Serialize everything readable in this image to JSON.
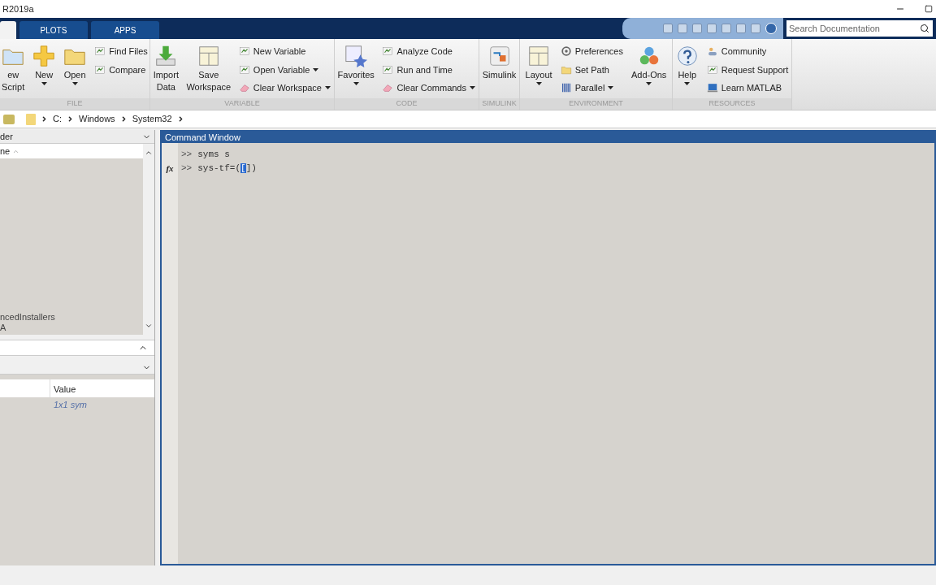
{
  "window": {
    "title": "R2019a"
  },
  "tabs": [
    {
      "selected": true
    },
    {
      "label": "PLOTS",
      "selected": false
    },
    {
      "label": "APPS",
      "selected": false
    }
  ],
  "search": {
    "placeholder": "Search Documentation"
  },
  "ribbon": [
    {
      "label": "FILE",
      "items": [
        {
          "kind": "large",
          "lines": [
            "ew",
            "Script"
          ],
          "dropdown": false
        },
        {
          "kind": "large",
          "lines": [
            "New"
          ],
          "dropdown": true
        },
        {
          "kind": "large",
          "lines": [
            "Open"
          ],
          "dropdown": true
        },
        {
          "kind": "stack",
          "items": [
            {
              "label": "Find Files",
              "dropdown": false
            },
            {
              "label": "Compare",
              "dropdown": false
            }
          ]
        }
      ]
    },
    {
      "label": "VARIABLE",
      "items": [
        {
          "kind": "large",
          "lines": [
            "Import",
            "Data"
          ],
          "dropdown": false
        },
        {
          "kind": "large",
          "lines": [
            "Save",
            "Workspace"
          ],
          "dropdown": false
        },
        {
          "kind": "stack",
          "items": [
            {
              "label": "New Variable",
              "dropdown": false
            },
            {
              "label": "Open Variable",
              "dropdown": true
            },
            {
              "label": "Clear Workspace",
              "dropdown": true
            }
          ]
        }
      ]
    },
    {
      "label": "CODE",
      "items": [
        {
          "kind": "large",
          "lines": [
            "Favorites"
          ],
          "dropdown": true
        },
        {
          "kind": "stack",
          "items": [
            {
              "label": "Analyze Code",
              "dropdown": false
            },
            {
              "label": "Run and Time",
              "dropdown": false
            },
            {
              "label": "Clear Commands",
              "dropdown": true
            }
          ]
        }
      ]
    },
    {
      "label": "SIMULINK",
      "items": [
        {
          "kind": "large",
          "lines": [
            "Simulink"
          ],
          "dropdown": false
        }
      ]
    },
    {
      "label": "ENVIRONMENT",
      "items": [
        {
          "kind": "large",
          "lines": [
            "Layout"
          ],
          "dropdown": true
        },
        {
          "kind": "stack",
          "items": [
            {
              "label": "Preferences",
              "dropdown": false
            },
            {
              "label": "Set Path",
              "dropdown": false
            },
            {
              "label": "Parallel",
              "dropdown": true
            }
          ]
        },
        {
          "kind": "large",
          "lines": [
            "Add-Ons"
          ],
          "dropdown": true
        }
      ]
    },
    {
      "label": "RESOURCES",
      "items": [
        {
          "kind": "large",
          "lines": [
            "Help"
          ],
          "dropdown": true
        },
        {
          "kind": "stack",
          "items": [
            {
              "label": "Community",
              "dropdown": false
            },
            {
              "label": "Request Support",
              "dropdown": false
            },
            {
              "label": "Learn MATLAB",
              "dropdown": false
            }
          ]
        }
      ]
    }
  ],
  "address": [
    "C:",
    "Windows",
    "System32"
  ],
  "current_folder": {
    "title": "der",
    "column": "ne",
    "rows": [
      "ncedInstallers",
      "A"
    ]
  },
  "workspace": {
    "column": "Value",
    "rows": [
      {
        "value": "1x1 sym"
      }
    ]
  },
  "command_window": {
    "title": "Command Window",
    "gutter_icon": "fx",
    "lines": [
      {
        "prompt": ">>",
        "text": "syms s"
      },
      {
        "prompt": ">>",
        "text": "sys-tf=(",
        "selection": "[",
        "after": "])"
      }
    ]
  }
}
